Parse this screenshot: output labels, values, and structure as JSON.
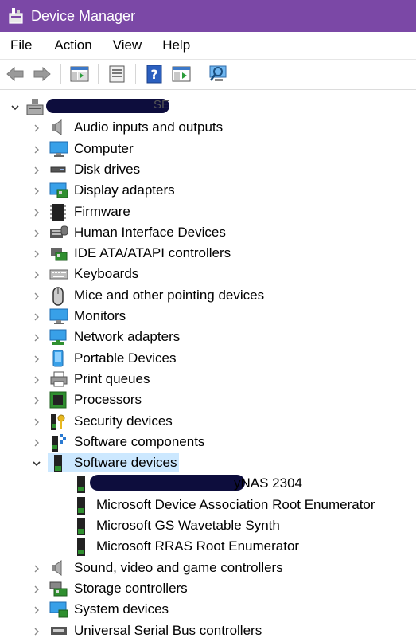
{
  "window": {
    "title": "Device Manager"
  },
  "menu": [
    "File",
    "Action",
    "View",
    "Help"
  ],
  "toolbar": [
    {
      "icon": "back-arrow-icon"
    },
    {
      "icon": "forward-arrow-icon"
    },
    {
      "icon": "show-hide-console-tree-icon"
    },
    {
      "icon": "properties-icon"
    },
    {
      "icon": "help-icon"
    },
    {
      "icon": "run-action-icon"
    },
    {
      "icon": "scan-hardware-changes-icon"
    }
  ],
  "tree": {
    "root_suffix": "SE",
    "categories": [
      {
        "label": "Audio inputs and outputs",
        "icon": "speaker-icon",
        "expanded": false
      },
      {
        "label": "Computer",
        "icon": "computer-icon",
        "expanded": false
      },
      {
        "label": "Disk drives",
        "icon": "disk-drive-icon",
        "expanded": false
      },
      {
        "label": "Display adapters",
        "icon": "display-adapter-icon",
        "expanded": false
      },
      {
        "label": "Firmware",
        "icon": "firmware-chip-icon",
        "expanded": false
      },
      {
        "label": "Human Interface Devices",
        "icon": "hid-icon",
        "expanded": false
      },
      {
        "label": "IDE ATA/ATAPI controllers",
        "icon": "ide-controller-icon",
        "expanded": false
      },
      {
        "label": "Keyboards",
        "icon": "keyboard-icon",
        "expanded": false
      },
      {
        "label": "Mice and other pointing devices",
        "icon": "mouse-icon",
        "expanded": false
      },
      {
        "label": "Monitors",
        "icon": "monitor-icon",
        "expanded": false
      },
      {
        "label": "Network adapters",
        "icon": "network-adapter-icon",
        "expanded": false
      },
      {
        "label": "Portable Devices",
        "icon": "portable-device-icon",
        "expanded": false
      },
      {
        "label": "Print queues",
        "icon": "printer-icon",
        "expanded": false
      },
      {
        "label": "Processors",
        "icon": "processor-icon",
        "expanded": false
      },
      {
        "label": "Security devices",
        "icon": "security-device-icon",
        "expanded": false
      },
      {
        "label": "Software components",
        "icon": "software-component-icon",
        "expanded": false
      },
      {
        "label": "Software devices",
        "icon": "software-device-icon",
        "expanded": true,
        "selected": true,
        "children": [
          {
            "label": "yNAS 2304",
            "redacted_prefix": true
          },
          {
            "label": "Microsoft Device Association Root Enumerator"
          },
          {
            "label": "Microsoft GS Wavetable Synth"
          },
          {
            "label": "Microsoft RRAS Root Enumerator"
          }
        ]
      },
      {
        "label": "Sound, video and game controllers",
        "icon": "sound-video-icon",
        "expanded": false
      },
      {
        "label": "Storage controllers",
        "icon": "storage-controller-icon",
        "expanded": false
      },
      {
        "label": "System devices",
        "icon": "system-device-icon",
        "expanded": false
      },
      {
        "label": "Universal Serial Bus controllers",
        "icon": "usb-icon",
        "expanded": false
      }
    ]
  },
  "colors": {
    "titlebar": "#7b48a6",
    "selection": "#cce8ff",
    "redaction": "#0d0d3d"
  }
}
